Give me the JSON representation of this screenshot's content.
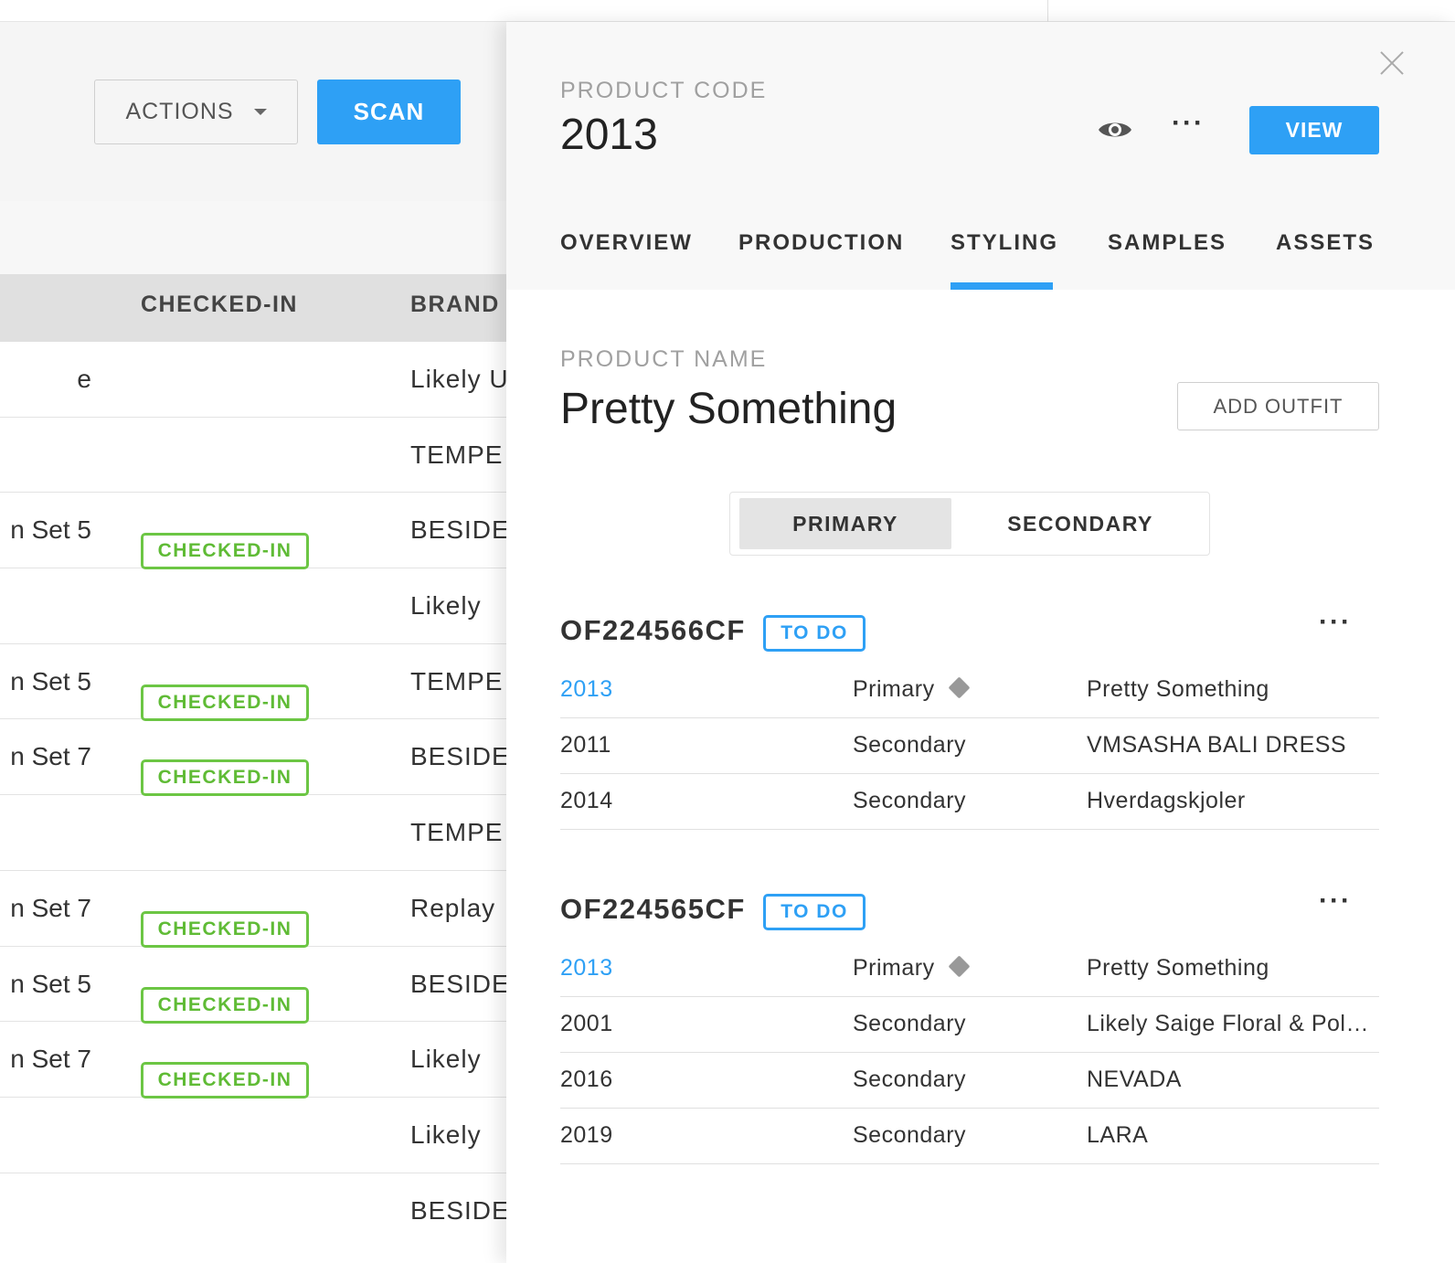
{
  "toolbar": {
    "actions_label": "ACTIONS",
    "scan_label": "SCAN"
  },
  "table": {
    "headers": {
      "checked_in": "CHECKED-IN",
      "brand": "BRAND"
    },
    "rows": [
      {
        "name": "e",
        "status": "",
        "brand": "Likely U"
      },
      {
        "name": "",
        "status": "",
        "brand": "TEMPE"
      },
      {
        "name": "n Set 5",
        "status": "CHECKED-IN",
        "brand": "BESIDE"
      },
      {
        "name": "",
        "status": "",
        "brand": "Likely"
      },
      {
        "name": "n Set 5",
        "status": "CHECKED-IN",
        "brand": "TEMPE"
      },
      {
        "name": "n Set 7",
        "status": "CHECKED-IN",
        "brand": "BESIDE"
      },
      {
        "name": "",
        "status": "",
        "brand": "TEMPE"
      },
      {
        "name": "n Set 7",
        "status": "CHECKED-IN",
        "brand": "Replay"
      },
      {
        "name": "n Set 5",
        "status": "CHECKED-IN",
        "brand": "BESIDE"
      },
      {
        "name": "n Set 7",
        "status": "CHECKED-IN",
        "brand": "Likely"
      },
      {
        "name": "",
        "status": "",
        "brand": "Likely"
      },
      {
        "name": "",
        "status": "",
        "brand": "BESIDE"
      }
    ]
  },
  "drawer": {
    "product_code_label": "PRODUCT CODE",
    "product_code": "2013",
    "view_label": "VIEW",
    "more_label": "···",
    "tabs": [
      {
        "label": "OVERVIEW"
      },
      {
        "label": "PRODUCTION"
      },
      {
        "label": "STYLING"
      },
      {
        "label": "SAMPLES"
      },
      {
        "label": "ASSETS"
      }
    ],
    "active_tab": "STYLING",
    "product_name_label": "PRODUCT NAME",
    "product_name": "Pretty Something",
    "add_outfit_label": "ADD OUTFIT",
    "segment": {
      "primary": "PRIMARY",
      "secondary": "SECONDARY",
      "selected": "PRIMARY"
    },
    "outfits": [
      {
        "code": "OF224566CF",
        "status": "TO DO",
        "more": "···",
        "rows": [
          {
            "code": "2013",
            "type": "Primary",
            "name": "Pretty Something"
          },
          {
            "code": "2011",
            "type": "Secondary",
            "name": "VMSASHA BALI DRESS"
          },
          {
            "code": "2014",
            "type": "Secondary",
            "name": "Hverdagskjoler"
          }
        ]
      },
      {
        "code": "OF224565CF",
        "status": "TO DO",
        "more": "···",
        "rows": [
          {
            "code": "2013",
            "type": "Primary",
            "name": "Pretty Something"
          },
          {
            "code": "2001",
            "type": "Secondary",
            "name": "Likely Saige Floral & Polk…"
          },
          {
            "code": "2016",
            "type": "Secondary",
            "name": "NEVADA"
          },
          {
            "code": "2019",
            "type": "Secondary",
            "name": "LARA"
          }
        ]
      }
    ]
  },
  "colors": {
    "accent": "#2ea0f5",
    "checked_in": "#6cc644",
    "header_bg": "#e0e0e0"
  },
  "icons": {
    "eye": "eye-icon",
    "close": "close-icon",
    "caret": "caret-down-icon",
    "primary_marker": "diamond-icon"
  }
}
